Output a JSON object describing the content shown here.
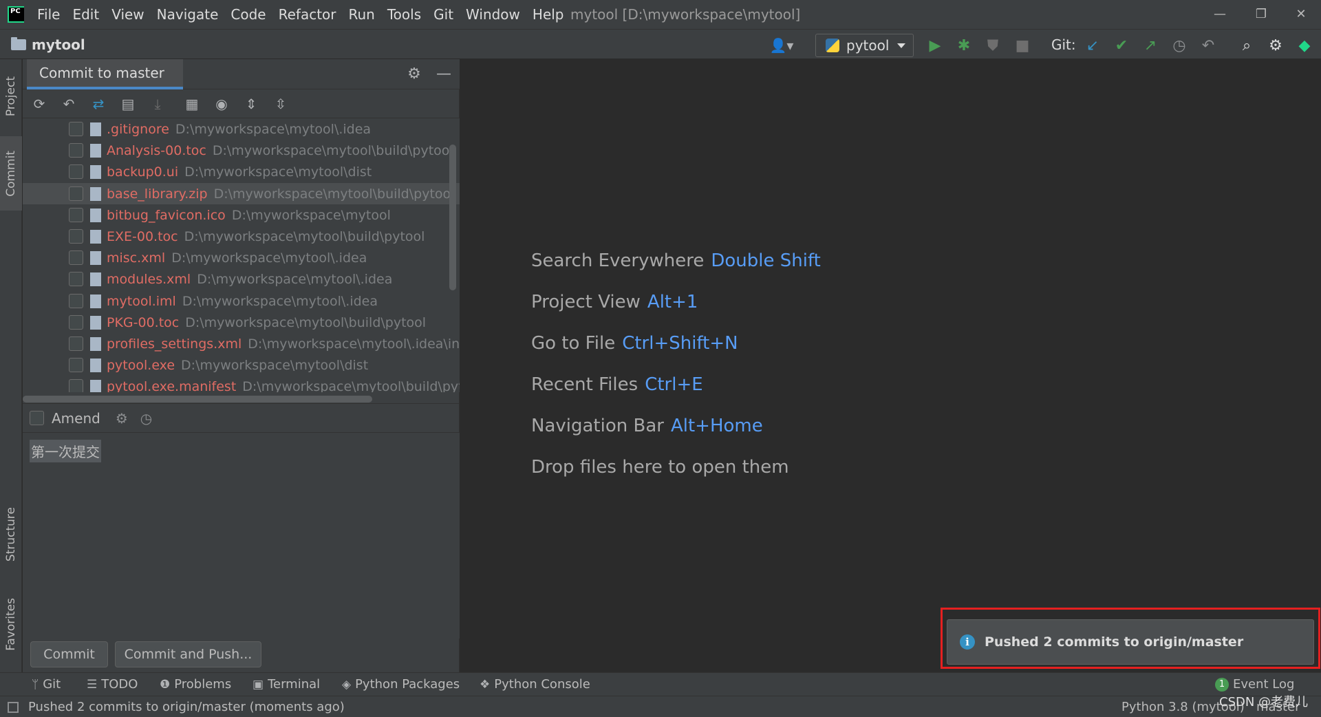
{
  "window": {
    "title": "mytool [D:\\myworkspace\\mytool]",
    "menus": [
      "File",
      "Edit",
      "View",
      "Navigate",
      "Code",
      "Refactor",
      "Run",
      "Tools",
      "Git",
      "Window",
      "Help"
    ],
    "controls": {
      "minimize": "—",
      "restore": "❐",
      "close": "✕"
    }
  },
  "navbar": {
    "project_name": "mytool",
    "run_config": "pytool",
    "git_label": "Git:"
  },
  "left_strip": {
    "project": "Project",
    "commit": "Commit",
    "structure": "Structure",
    "favorites": "Favorites"
  },
  "commit_panel": {
    "tab_label": "Commit to master",
    "files": [
      {
        "name": ".gitignore",
        "path": "D:\\myworkspace\\mytool\\.idea"
      },
      {
        "name": "Analysis-00.toc",
        "path": "D:\\myworkspace\\mytool\\build\\pytool"
      },
      {
        "name": "backup0.ui",
        "path": "D:\\myworkspace\\mytool\\dist"
      },
      {
        "name": "base_library.zip",
        "path": "D:\\myworkspace\\mytool\\build\\pytool"
      },
      {
        "name": "bitbug_favicon.ico",
        "path": "D:\\myworkspace\\mytool"
      },
      {
        "name": "EXE-00.toc",
        "path": "D:\\myworkspace\\mytool\\build\\pytool"
      },
      {
        "name": "misc.xml",
        "path": "D:\\myworkspace\\mytool\\.idea"
      },
      {
        "name": "modules.xml",
        "path": "D:\\myworkspace\\mytool\\.idea"
      },
      {
        "name": "mytool.iml",
        "path": "D:\\myworkspace\\mytool\\.idea"
      },
      {
        "name": "PKG-00.toc",
        "path": "D:\\myworkspace\\mytool\\build\\pytool"
      },
      {
        "name": "profiles_settings.xml",
        "path": "D:\\myworkspace\\mytool\\.idea\\inspec"
      },
      {
        "name": "pytool.exe",
        "path": "D:\\myworkspace\\mytool\\dist"
      },
      {
        "name": "pytool.exe.manifest",
        "path": "D:\\myworkspace\\mytool\\build\\pytool"
      }
    ],
    "selected_file_index": 3,
    "amend_label": "Amend",
    "commit_message": "第一次提交",
    "commit_button": "Commit",
    "commit_push_button": "Commit and Push..."
  },
  "editor": {
    "hints": [
      {
        "label": "Search Everywhere",
        "key": "Double Shift"
      },
      {
        "label": "Project View",
        "key": "Alt+1"
      },
      {
        "label": "Go to File",
        "key": "Ctrl+Shift+N"
      },
      {
        "label": "Recent Files",
        "key": "Ctrl+E"
      },
      {
        "label": "Navigation Bar",
        "key": "Alt+Home"
      },
      {
        "label": "Drop files here to open them",
        "key": ""
      }
    ]
  },
  "notification": {
    "text": "Pushed 2 commits to origin/master",
    "icon": "info-icon"
  },
  "tool_windows": {
    "git": "Git",
    "todo": "TODO",
    "problems": "Problems",
    "terminal": "Terminal",
    "python_packages": "Python Packages",
    "python_console": "Python Console",
    "event_log": "Event Log",
    "event_log_count": "1"
  },
  "statusbar": {
    "message": "Pushed 2 commits to origin/master (moments ago)",
    "interpreter": "Python 3.8 (mytool)",
    "branch": "master",
    "watermark": "CSDN @老费儿"
  },
  "colors": {
    "accent": "#4a88c7",
    "unversioned_file": "#e06c64",
    "shortcut_key": "#589df6",
    "highlight_outline": "#e52020"
  }
}
